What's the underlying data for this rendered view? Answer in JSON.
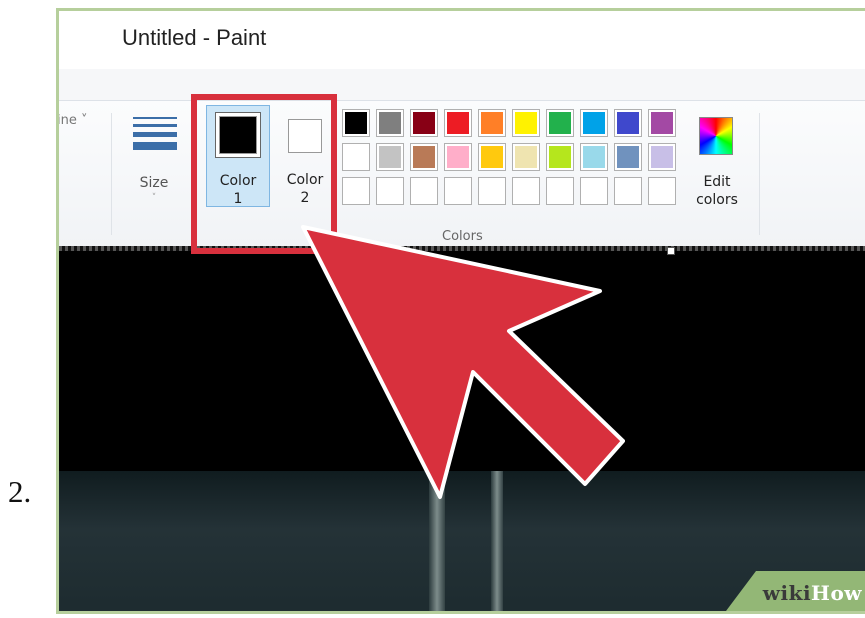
{
  "step": {
    "number": "2."
  },
  "window": {
    "title": "Untitled - Paint"
  },
  "ribbon": {
    "outline_label": "ine",
    "outline_chevron": "˅",
    "size_label": "Size",
    "size_chevron": "˅",
    "color1": {
      "label_line1": "Color",
      "label_line2": "1",
      "value": "#000000",
      "selected": true
    },
    "color2": {
      "label_line1": "Color",
      "label_line2": "2",
      "value": "#ffffff"
    },
    "palette": {
      "rows": [
        [
          "#000000",
          "#7f7f7f",
          "#880015",
          "#ed1c24",
          "#ff7f27",
          "#fff200",
          "#22b14c",
          "#00a2e8",
          "#3f48cc",
          "#a349a4"
        ],
        [
          "#ffffff",
          "#c3c3c3",
          "#b97a57",
          "#ffaec9",
          "#ffc90e",
          "#efe4b0",
          "#b5e61d",
          "#99d9ea",
          "#7092be",
          "#c8bfe7"
        ],
        [
          "#ffffff",
          "#ffffff",
          "#ffffff",
          "#ffffff",
          "#ffffff",
          "#ffffff",
          "#ffffff",
          "#ffffff",
          "#ffffff",
          "#ffffff"
        ]
      ]
    },
    "edit_colors": {
      "line1": "Edit",
      "line2": "colors"
    },
    "group_label": "Colors"
  },
  "annotation": {
    "highlight_color": "#d8303d",
    "arrow_color": "#d8303d"
  },
  "watermark": {
    "part1": "wiki",
    "part2": "How"
  }
}
